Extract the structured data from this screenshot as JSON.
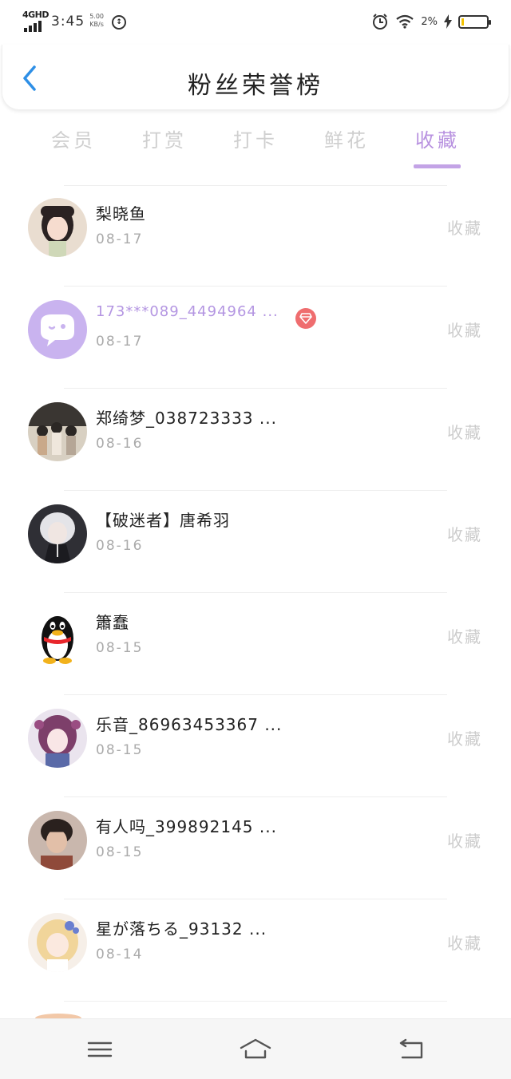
{
  "status_bar": {
    "network": "4GHD",
    "time": "3:45",
    "speed_value": "5.00",
    "speed_unit": "KB/s",
    "battery_percent": "2%",
    "icons": [
      "signal-icon",
      "data-saver-icon",
      "alarm-icon",
      "wifi-icon",
      "charging-icon",
      "battery-icon"
    ]
  },
  "header": {
    "title": "粉丝荣誉榜",
    "back_icon": "chevron-left-icon"
  },
  "tabs": [
    {
      "label": "会员",
      "active": false
    },
    {
      "label": "打赏",
      "active": false
    },
    {
      "label": "打卡",
      "active": false
    },
    {
      "label": "鲜花",
      "active": false
    },
    {
      "label": "收藏",
      "active": true
    }
  ],
  "fans": [
    {
      "name": "梨晓鱼",
      "date": "08-17",
      "action": "收藏",
      "avatar": "photo-girl-avatar"
    },
    {
      "name": "173***089_4494964 ...",
      "date": "08-17",
      "action": "收藏",
      "avatar": "default-chat-avatar",
      "vip": true
    },
    {
      "name": "郑绮梦_038723333 ...",
      "date": "08-16",
      "action": "收藏",
      "avatar": "photo-group-avatar"
    },
    {
      "name": "【破迷者】唐希羽",
      "date": "08-16",
      "action": "收藏",
      "avatar": "anime-dark-avatar"
    },
    {
      "name": "簫蠢",
      "date": "08-15",
      "action": "收藏",
      "avatar": "qq-penguin-avatar"
    },
    {
      "name": "乐音_86963453367 ...",
      "date": "08-15",
      "action": "收藏",
      "avatar": "anime-girl-avatar"
    },
    {
      "name": "有人吗_399892145 ...",
      "date": "08-15",
      "action": "收藏",
      "avatar": "photo-boy-avatar"
    },
    {
      "name": "星が落ちる_93132 ...",
      "date": "08-14",
      "action": "收藏",
      "avatar": "anime-blonde-avatar"
    }
  ],
  "colors": {
    "accent": "#b892e0",
    "inactive_tab": "#cfcfcf",
    "vip_badge": "#ef6d6f",
    "date": "#aaaaaa",
    "action": "#cccccc"
  },
  "nav_bar": [
    "menu-icon",
    "home-icon",
    "back-icon"
  ]
}
